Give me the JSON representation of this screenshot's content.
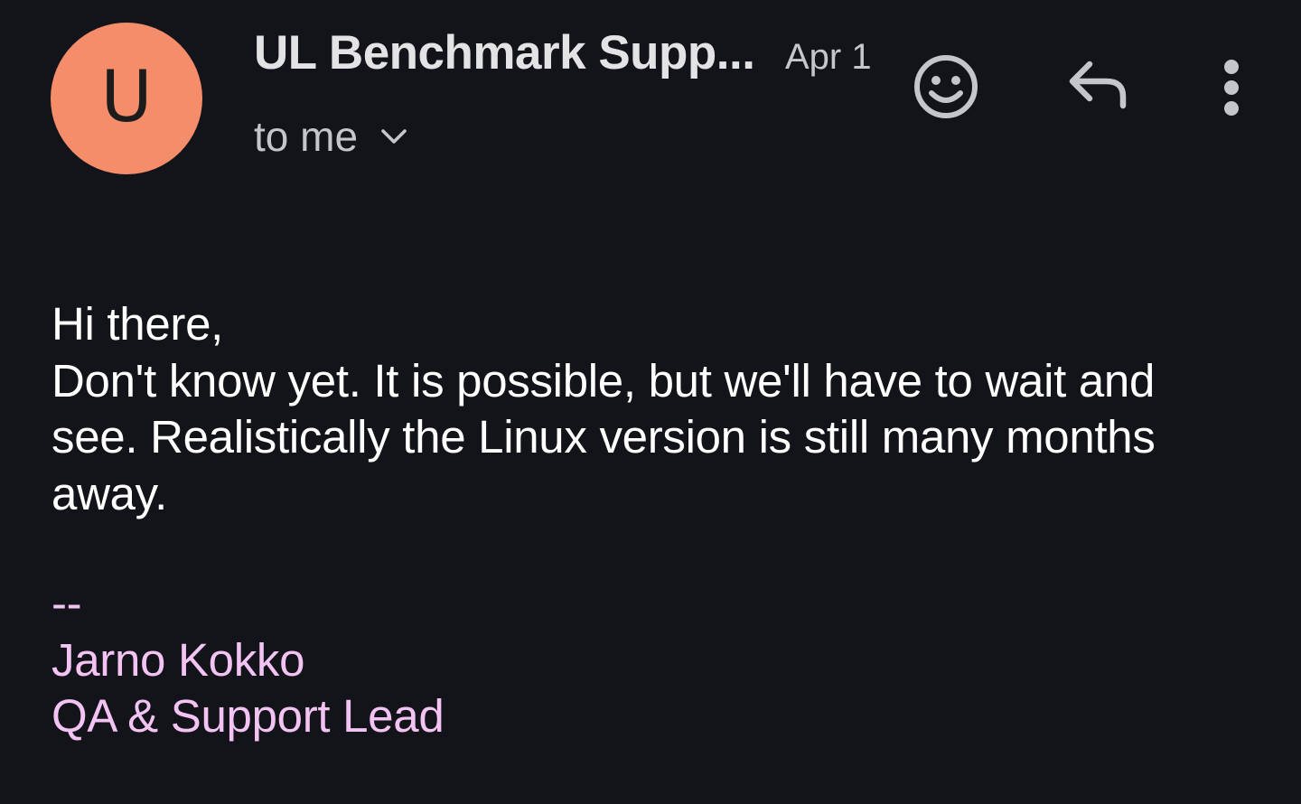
{
  "header": {
    "avatar_letter": "U",
    "avatar_color": "#f58d6a",
    "sender_name": "UL Benchmark Supp...",
    "date": "Apr 1",
    "recipient": "to me",
    "icons": {
      "expand": "chevron-down-icon",
      "emoji": "add-reaction-icon",
      "reply": "reply-icon",
      "more": "more-vert-icon"
    }
  },
  "message": {
    "greeting": "Hi there,",
    "body": "Don't know yet. It is possible, but we'll have to wait and see. Realistically the Linux version is still many months away."
  },
  "signature": {
    "separator": "--",
    "name": "Jarno Kokko",
    "title": "QA & Support Lead",
    "color": "#f3c4f3"
  },
  "colors": {
    "background": "#131419",
    "text": "#ffffff",
    "secondary_text": "#c4c6cc"
  }
}
